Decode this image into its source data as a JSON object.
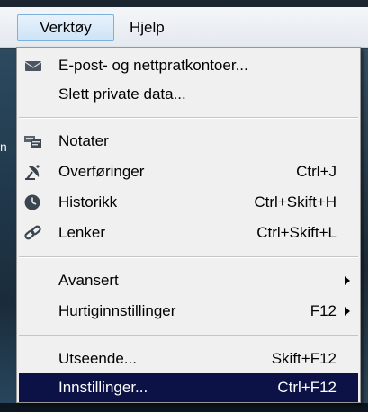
{
  "menubar": {
    "items": [
      {
        "label": "Verktøy",
        "active": true
      },
      {
        "label": "Hjelp",
        "active": false
      }
    ]
  },
  "backdrop": {
    "edge_label": "n"
  },
  "menu": {
    "items": [
      {
        "label": "E-post- og nettpratkontoer...",
        "shortcut": "",
        "icon": "envelope-icon",
        "submenu": false
      },
      {
        "label": "Slett private data...",
        "shortcut": "",
        "icon": "",
        "submenu": false
      },
      {
        "label": "Notater",
        "shortcut": "",
        "icon": "notes-icon",
        "submenu": false
      },
      {
        "label": "Overføringer",
        "shortcut": "Ctrl+J",
        "icon": "satellite-dish-icon",
        "submenu": false
      },
      {
        "label": "Historikk",
        "shortcut": "Ctrl+Skift+H",
        "icon": "clock-icon",
        "submenu": false
      },
      {
        "label": "Lenker",
        "shortcut": "Ctrl+Skift+L",
        "icon": "chain-link-icon",
        "submenu": false
      },
      {
        "label": "Avansert",
        "shortcut": "",
        "icon": "",
        "submenu": true
      },
      {
        "label": "Hurtiginnstillinger",
        "shortcut": "F12",
        "icon": "",
        "submenu": true
      },
      {
        "label": "Utseende...",
        "shortcut": "Skift+F12",
        "icon": "",
        "submenu": false
      },
      {
        "label": "Innstillinger...",
        "shortcut": "Ctrl+F12",
        "icon": "",
        "submenu": false,
        "selected": true
      }
    ]
  },
  "colors": {
    "selection": "#0c1246",
    "menu_bg": "#f0f0f0",
    "menubar_active_border": "#7eb0dc"
  }
}
